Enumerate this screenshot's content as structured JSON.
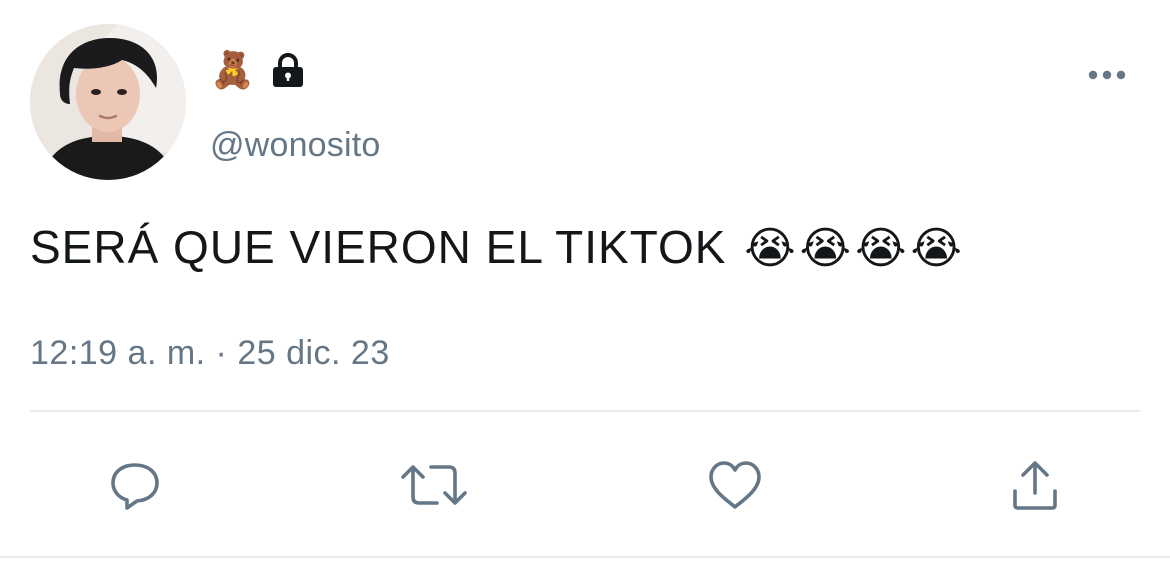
{
  "tweet": {
    "name_emoji": "🧸",
    "name_icon": "lock-icon",
    "handle": "@wonosito",
    "text": "SERÁ QUE VIERON EL TIKTOK",
    "text_emojis": [
      "😭",
      "😭",
      "😭",
      "😭"
    ],
    "timestamp": "12:19 a. m. · 25 dic. 23"
  },
  "header": {
    "more_icon": "more-horizontal-icon"
  },
  "actions": [
    {
      "name": "reply",
      "icon": "reply-icon"
    },
    {
      "name": "retweet",
      "icon": "retweet-icon"
    },
    {
      "name": "like",
      "icon": "heart-icon"
    },
    {
      "name": "share",
      "icon": "share-icon"
    }
  ],
  "colors": {
    "text": "#14171a",
    "secondary": "#657786",
    "divider": "#e6ecf0"
  }
}
